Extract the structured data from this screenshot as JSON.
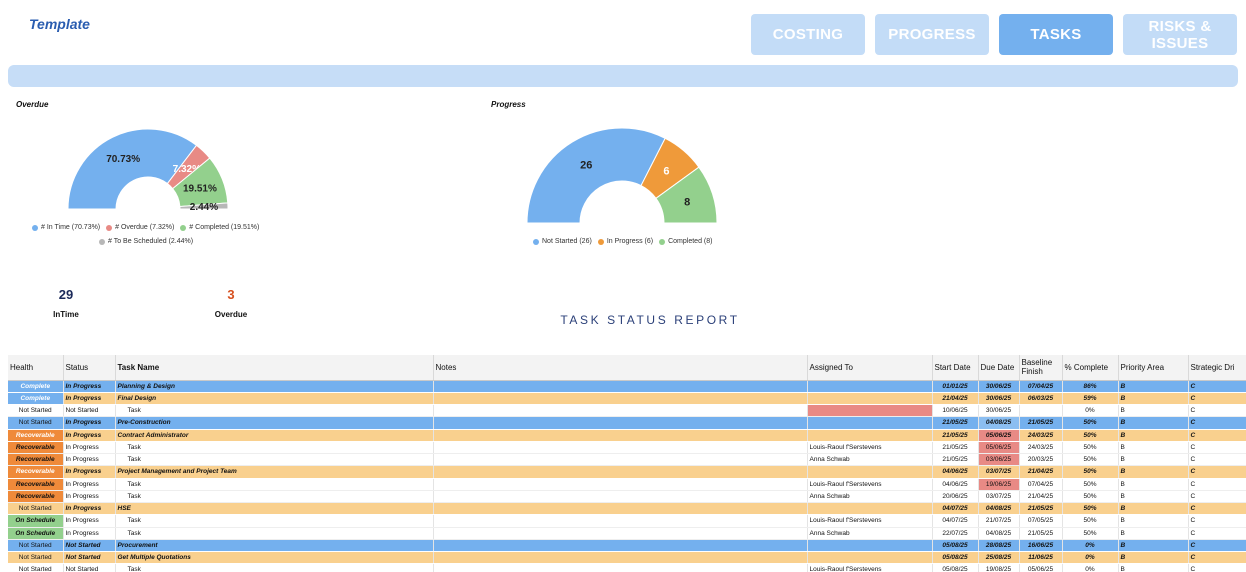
{
  "title": "Template",
  "nav": [
    {
      "label": "COSTING",
      "active": false
    },
    {
      "label": "PROGRESS",
      "active": false
    },
    {
      "label": "TASKS",
      "active": true
    },
    {
      "label": "RISKS & ISSUES",
      "active": false
    }
  ],
  "colors": {
    "blue": "#74b0ee",
    "red": "#e88a85",
    "green": "#93d08d",
    "grey": "#b7b7b7",
    "orange": "#ef9a3a",
    "section_orange": "#f9d08e",
    "overdue_num": "#d6501f",
    "intime_num": "#1b2a5a"
  },
  "chart_data": [
    {
      "type": "pie",
      "title": "Overdue",
      "categories": [
        "# In Time",
        "# Overdue",
        "# Completed",
        "# To Be Scheduled"
      ],
      "values": [
        70.73,
        7.32,
        19.51,
        2.44
      ],
      "value_labels": [
        "70.73%",
        "7.32%",
        "19.51%",
        "2.44%"
      ],
      "legend": [
        {
          "label": "# In Time (70.73%)",
          "color": "#74b0ee"
        },
        {
          "label": "# Overdue (7.32%)",
          "color": "#e88a85"
        },
        {
          "label": "# Completed (19.51%)",
          "color": "#93d08d"
        },
        {
          "label": "# To Be Scheduled (2.44%)",
          "color": "#b7b7b7"
        }
      ],
      "legend_position": "bottom"
    },
    {
      "type": "pie",
      "title": "Progress",
      "categories": [
        "Not Started",
        "In Progress",
        "Completed"
      ],
      "values": [
        26,
        6,
        8
      ],
      "value_labels": [
        "26",
        "6",
        "8"
      ],
      "legend": [
        {
          "label": "Not Started (26)",
          "color": "#74b0ee"
        },
        {
          "label": "In Progress (6)",
          "color": "#ef9a3a"
        },
        {
          "label": "Completed (8)",
          "color": "#93d08d"
        }
      ],
      "legend_position": "bottom"
    }
  ],
  "kpis": {
    "intime": {
      "value": "29",
      "label": "InTime"
    },
    "overdue": {
      "value": "3",
      "label": "Overdue"
    }
  },
  "report_title": "TASK STATUS REPORT",
  "table": {
    "headers": [
      "Health",
      "Status",
      "Task Name",
      "Notes",
      "Assigned To",
      "Start Date",
      "Due Date",
      "Baseline Finish",
      "% Complete",
      "Priority Area",
      "Strategic Dri"
    ],
    "rows": [
      {
        "kind": "blue",
        "health": "Complete",
        "hcolor": "#74b0ee",
        "status": "In Progress",
        "task": "Planning & Design",
        "notes": "",
        "assigned": "",
        "start": "01/01/25",
        "due": "30/06/25",
        "baseline": "07/04/25",
        "pct": "86%",
        "priority": "B",
        "strategic": "C",
        "due_hl": ""
      },
      {
        "kind": "orange",
        "health": "Complete",
        "hcolor": "#74b0ee",
        "status": "In Progress",
        "task": "Final Design",
        "notes": "",
        "assigned": "",
        "start": "21/04/25",
        "due": "30/06/25",
        "baseline": "06/03/25",
        "pct": "59%",
        "priority": "B",
        "strategic": "C",
        "due_hl": ""
      },
      {
        "kind": "plain",
        "health": "Not Started",
        "hcolor": "",
        "status": "Not Started",
        "task": "Task",
        "notes": "",
        "assigned": "",
        "assigned_hl": "red",
        "start": "10/06/25",
        "due": "30/06/25",
        "baseline": "",
        "pct": "0%",
        "priority": "B",
        "strategic": "C",
        "due_hl": ""
      },
      {
        "kind": "blue",
        "health": "Not Started",
        "hcolor": "",
        "status": "In Progress",
        "task": "Pre-Construction",
        "notes": "",
        "assigned": "",
        "start": "21/05/25",
        "due": "04/08/25",
        "baseline": "21/05/25",
        "pct": "50%",
        "priority": "B",
        "strategic": "C",
        "due_hl": "blue"
      },
      {
        "kind": "orange",
        "health": "Recoverable",
        "hcolor": "#ef8a3a",
        "status": "In Progress",
        "task": "Contract Administrator",
        "notes": "",
        "assigned": "",
        "start": "21/05/25",
        "due": "05/06/25",
        "baseline": "24/03/25",
        "pct": "50%",
        "priority": "B",
        "strategic": "C",
        "due_hl": "red"
      },
      {
        "kind": "plain",
        "health": "Recoverable",
        "hcolor": "#ef8a3a",
        "status": "In Progress",
        "task": "Task",
        "notes": "",
        "assigned": "Louis-Raoul f'Serstevens",
        "start": "21/05/25",
        "due": "05/06/25",
        "baseline": "24/03/25",
        "pct": "50%",
        "priority": "B",
        "strategic": "C",
        "due_hl": "red"
      },
      {
        "kind": "plain",
        "health": "Recoverable",
        "hcolor": "#ef8a3a",
        "status": "In Progress",
        "task": "Task",
        "notes": "",
        "assigned": "Anna Schwab",
        "start": "21/05/25",
        "due": "03/06/25",
        "baseline": "20/03/25",
        "pct": "50%",
        "priority": "B",
        "strategic": "C",
        "due_hl": "red"
      },
      {
        "kind": "orange",
        "health": "Recoverable",
        "hcolor": "#ef8a3a",
        "status": "In Progress",
        "task": "Project Management and Project Team",
        "notes": "",
        "assigned": "",
        "start": "04/06/25",
        "due": "03/07/25",
        "baseline": "21/04/25",
        "pct": "50%",
        "priority": "B",
        "strategic": "C",
        "due_hl": ""
      },
      {
        "kind": "plain",
        "health": "Recoverable",
        "hcolor": "#ef8a3a",
        "status": "In Progress",
        "task": "Task",
        "notes": "",
        "assigned": "Louis-Raoul f'Serstevens",
        "start": "04/06/25",
        "due": "19/06/25",
        "baseline": "07/04/25",
        "pct": "50%",
        "priority": "B",
        "strategic": "C",
        "due_hl": "red"
      },
      {
        "kind": "plain",
        "health": "Recoverable",
        "hcolor": "#ef8a3a",
        "status": "In Progress",
        "task": "Task",
        "notes": "",
        "assigned": "Anna Schwab",
        "start": "20/06/25",
        "due": "03/07/25",
        "baseline": "21/04/25",
        "pct": "50%",
        "priority": "B",
        "strategic": "C",
        "due_hl": ""
      },
      {
        "kind": "orange",
        "health": "Not Started",
        "hcolor": "",
        "status": "In Progress",
        "task": "HSE",
        "notes": "",
        "assigned": "",
        "start": "04/07/25",
        "due": "04/08/25",
        "baseline": "21/05/25",
        "pct": "50%",
        "priority": "B",
        "strategic": "C",
        "due_hl": ""
      },
      {
        "kind": "plain",
        "health": "On Schedule",
        "hcolor": "#93d08d",
        "status": "In Progress",
        "task": "Task",
        "notes": "",
        "assigned": "Louis-Raoul f'Serstevens",
        "start": "04/07/25",
        "due": "21/07/25",
        "baseline": "07/05/25",
        "pct": "50%",
        "priority": "B",
        "strategic": "C",
        "due_hl": ""
      },
      {
        "kind": "plain",
        "health": "On Schedule",
        "hcolor": "#93d08d",
        "status": "In Progress",
        "task": "Task",
        "notes": "",
        "assigned": "Anna Schwab",
        "start": "22/07/25",
        "due": "04/08/25",
        "baseline": "21/05/25",
        "pct": "50%",
        "priority": "B",
        "strategic": "C",
        "due_hl": ""
      },
      {
        "kind": "blue",
        "health": "Not Started",
        "hcolor": "",
        "status": "Not Started",
        "task": "Procurement",
        "notes": "",
        "assigned": "",
        "start": "05/08/25",
        "due": "28/08/25",
        "baseline": "16/06/25",
        "pct": "0%",
        "priority": "B",
        "strategic": "C",
        "due_hl": ""
      },
      {
        "kind": "orange",
        "health": "Not Started",
        "hcolor": "",
        "status": "Not Started",
        "task": "Get Multiple Quotations",
        "notes": "",
        "assigned": "",
        "start": "05/08/25",
        "due": "25/08/25",
        "baseline": "11/06/25",
        "pct": "0%",
        "priority": "B",
        "strategic": "C",
        "due_hl": ""
      },
      {
        "kind": "plain",
        "health": "Not Started",
        "hcolor": "",
        "status": "Not Started",
        "task": "Task",
        "notes": "",
        "assigned": "Louis-Raoul f'Serstevens",
        "start": "05/08/25",
        "due": "19/08/25",
        "baseline": "05/06/25",
        "pct": "0%",
        "priority": "B",
        "strategic": "C",
        "due_hl": ""
      }
    ]
  }
}
